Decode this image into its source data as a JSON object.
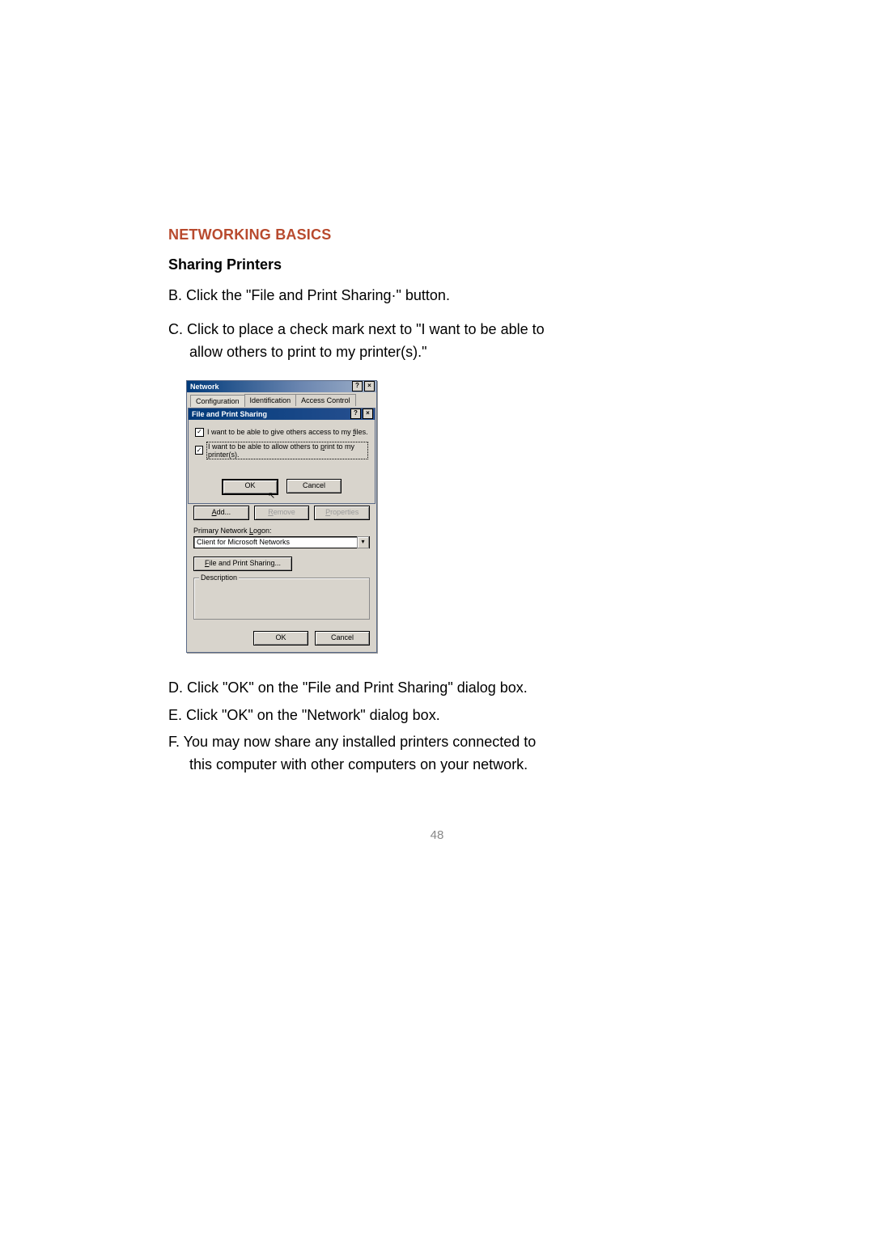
{
  "doc": {
    "heading": "NETWORKING BASICS",
    "subheading": "Sharing Printers",
    "step_b": "B. Click the \"File and Print Sharing·\" button.",
    "step_c_line1": "C. Click to place a check mark next to \"I want to be able to",
    "step_c_line2": "allow others to print to my printer(s).\"",
    "step_d": "D. Click \"OK\" on the \"File and Print Sharing\" dialog box.",
    "step_e": "E. Click \"OK\" on the \"Network\" dialog box.",
    "step_f_line1": "F. You may now share any installed printers connected to",
    "step_f_line2": "this computer with other computers on your network.",
    "page_number": "48"
  },
  "network_dialog": {
    "title": "Network",
    "help_btn": "?",
    "close_btn": "×",
    "tabs": {
      "configuration": "Configuration",
      "identification": "Identification",
      "access_control": "Access Control"
    },
    "buttons": {
      "add": "Add...",
      "add_key": "A",
      "remove": "Remove",
      "remove_key": "R",
      "properties": "Properties",
      "properties_key": "P",
      "file_print_sharing": "File and Print Sharing...",
      "fps_key": "F",
      "ok": "OK",
      "cancel": "Cancel"
    },
    "primary_logon_label": "Primary Network Logon:",
    "primary_logon_key": "L",
    "primary_logon_value": "Client for Microsoft Networks",
    "description_label": "Description"
  },
  "fps_dialog": {
    "title": "File and Print Sharing",
    "help_btn": "?",
    "close_btn": "×",
    "check1_text": "I want to be able to give others access to my files.",
    "check1_key": "f",
    "check1_checked": true,
    "check2_text": "I want to be able to allow others to print to my printer(s).",
    "check2_key": "p",
    "check2_checked": true,
    "ok": "OK",
    "cancel": "Cancel"
  }
}
